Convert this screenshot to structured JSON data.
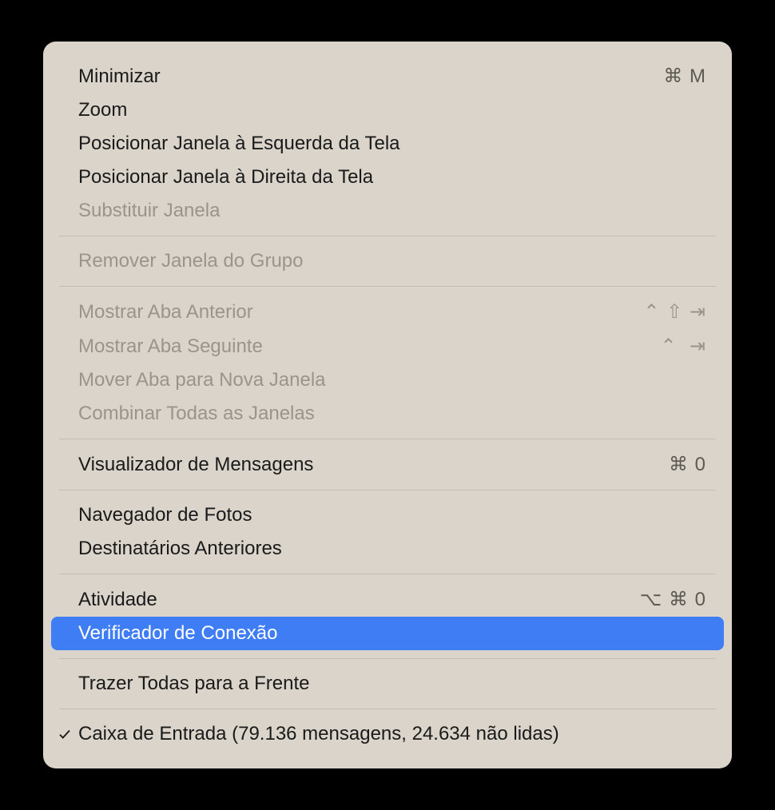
{
  "menu": {
    "groups": [
      [
        {
          "label": "Minimizar",
          "shortcut": "⌘ M",
          "disabled": false,
          "highlighted": false,
          "checked": false
        },
        {
          "label": "Zoom",
          "shortcut": "",
          "disabled": false,
          "highlighted": false,
          "checked": false
        },
        {
          "label": "Posicionar Janela à Esquerda da Tela",
          "shortcut": "",
          "disabled": false,
          "highlighted": false,
          "checked": false
        },
        {
          "label": "Posicionar Janela à Direita da Tela",
          "shortcut": "",
          "disabled": false,
          "highlighted": false,
          "checked": false
        },
        {
          "label": "Substituir Janela",
          "shortcut": "",
          "disabled": true,
          "highlighted": false,
          "checked": false
        }
      ],
      [
        {
          "label": "Remover Janela do Grupo",
          "shortcut": "",
          "disabled": true,
          "highlighted": false,
          "checked": false
        }
      ],
      [
        {
          "label": "Mostrar Aba Anterior",
          "shortcut": "⌃ ⇧ ⇥",
          "disabled": true,
          "highlighted": false,
          "checked": false
        },
        {
          "label": "Mostrar Aba Seguinte",
          "shortcut": "⌃  ⇥",
          "disabled": true,
          "highlighted": false,
          "checked": false
        },
        {
          "label": "Mover Aba para Nova Janela",
          "shortcut": "",
          "disabled": true,
          "highlighted": false,
          "checked": false
        },
        {
          "label": "Combinar Todas as Janelas",
          "shortcut": "",
          "disabled": true,
          "highlighted": false,
          "checked": false
        }
      ],
      [
        {
          "label": "Visualizador de Mensagens",
          "shortcut": "⌘ 0",
          "disabled": false,
          "highlighted": false,
          "checked": false
        }
      ],
      [
        {
          "label": "Navegador de Fotos",
          "shortcut": "",
          "disabled": false,
          "highlighted": false,
          "checked": false
        },
        {
          "label": "Destinatários Anteriores",
          "shortcut": "",
          "disabled": false,
          "highlighted": false,
          "checked": false
        }
      ],
      [
        {
          "label": "Atividade",
          "shortcut": "⌥ ⌘ 0",
          "disabled": false,
          "highlighted": false,
          "checked": false
        },
        {
          "label": "Verificador de Conexão",
          "shortcut": "",
          "disabled": false,
          "highlighted": true,
          "checked": false
        }
      ],
      [
        {
          "label": "Trazer Todas para a Frente",
          "shortcut": "",
          "disabled": false,
          "highlighted": false,
          "checked": false
        }
      ],
      [
        {
          "label": "Caixa de Entrada (79.136 mensagens, 24.634 não lidas)",
          "shortcut": "",
          "disabled": false,
          "highlighted": false,
          "checked": true
        }
      ]
    ]
  }
}
